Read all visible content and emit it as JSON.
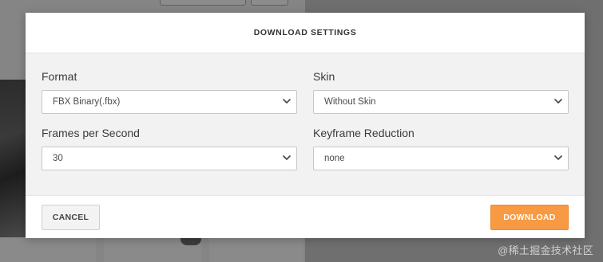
{
  "modal": {
    "title": "DOWNLOAD SETTINGS",
    "fields": [
      {
        "label": "Format",
        "value": "FBX Binary(.fbx)"
      },
      {
        "label": "Skin",
        "value": "Without Skin"
      },
      {
        "label": "Frames per Second",
        "value": "30"
      },
      {
        "label": "Keyframe Reduction",
        "value": "none"
      }
    ],
    "cancel_label": "CANCEL",
    "download_label": "DOWNLOAD"
  },
  "watermark": "@稀土掘金技术社区",
  "colors": {
    "accent": "#f79a43",
    "overlay": "#7e7e7e",
    "modal_body": "#f2f2f2"
  },
  "icons": {
    "select_arrow": "chevron-down-icon"
  }
}
